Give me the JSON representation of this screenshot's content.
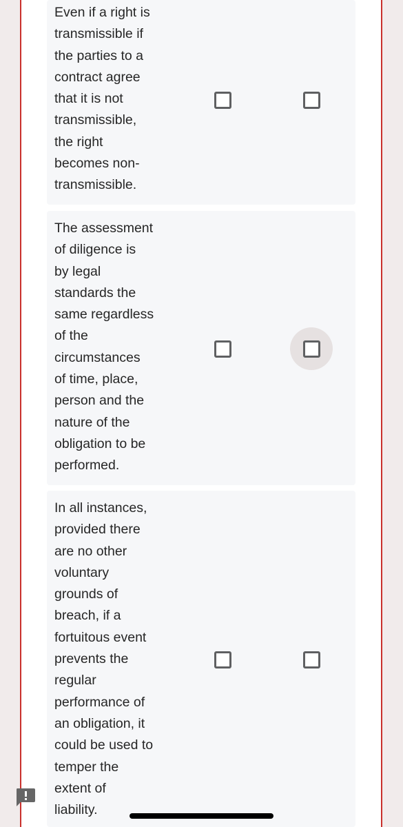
{
  "questions": [
    {
      "text": "Even if a right is\ntransmissible if\nthe parties to a\ncontract agree\nthat it is not\ntransmissible,\nthe right\nbecomes non-\ntransmissible.",
      "option_1_checked": false,
      "option_2_checked": false
    },
    {
      "text": "The assessment\nof diligence is\nby legal\nstandards the\nsame regardless\nof the\ncircumstances\nof time, place,\nperson and the\nnature of the\nobligation to be\nperformed.",
      "option_1_checked": false,
      "option_2_checked": false,
      "option_2_focused": true
    },
    {
      "text": "In all instances,\nprovided there\nare no other\nvoluntary\ngrounds of\nbreach, if a\nfortuitous event\nprevents the\nregular\nperformance of\nan obligation, it\ncould be used to\ntemper the\nextent of\nliability.",
      "option_1_checked": false,
      "option_2_checked": false
    }
  ],
  "icons": {
    "feedback": "feedback-exclamation-icon",
    "home": "home-indicator"
  },
  "colors": {
    "border_accent": "#c9302c",
    "card_bg": "#f6f7f9",
    "checkbox_border": "#5f6062",
    "focus_ripple": "#e6e1e1"
  }
}
